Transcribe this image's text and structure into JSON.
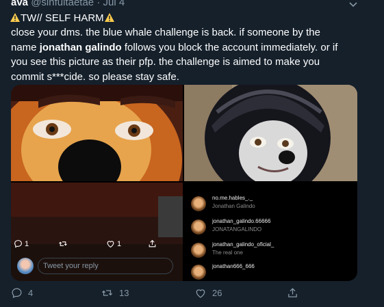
{
  "tweet": {
    "author_name": "ava",
    "handle": "@sinfultaetae",
    "separator": "·",
    "date": "Jul 4",
    "tw_label": "TW// SELF HARM",
    "body_part1": "close your dms.  the blue whale challenge is back. if someone by the name ",
    "body_bold": "jonathan galindo",
    "body_part2": " follows you block the account immediately. or if you see this picture as their pfp. the challenge is aimed to make you commit s***cide. so please stay safe."
  },
  "instagram_list": [
    {
      "username": "no.me.hables_._",
      "subtitle": "Jonathan Galindo"
    },
    {
      "username": "jonathan_galindo.66666",
      "subtitle": "JONATANGALINDO"
    },
    {
      "username": "jonathan_galindo_oficial_",
      "subtitle": "The real one"
    },
    {
      "username": "jonathan666_666",
      "subtitle": ""
    }
  ],
  "inner_actions": {
    "reply_count": "1",
    "like_count": "1"
  },
  "reply": {
    "placeholder": "Tweet your reply"
  },
  "actions": {
    "replies": "4",
    "retweets": "13",
    "likes": "26"
  },
  "colors": {
    "background": "#15202b",
    "muted": "#8899a6",
    "warning": "#ffcc4d"
  },
  "icons": [
    "warning-icon",
    "chevron-down-icon",
    "reply-icon",
    "retweet-icon",
    "like-icon",
    "share-icon"
  ]
}
